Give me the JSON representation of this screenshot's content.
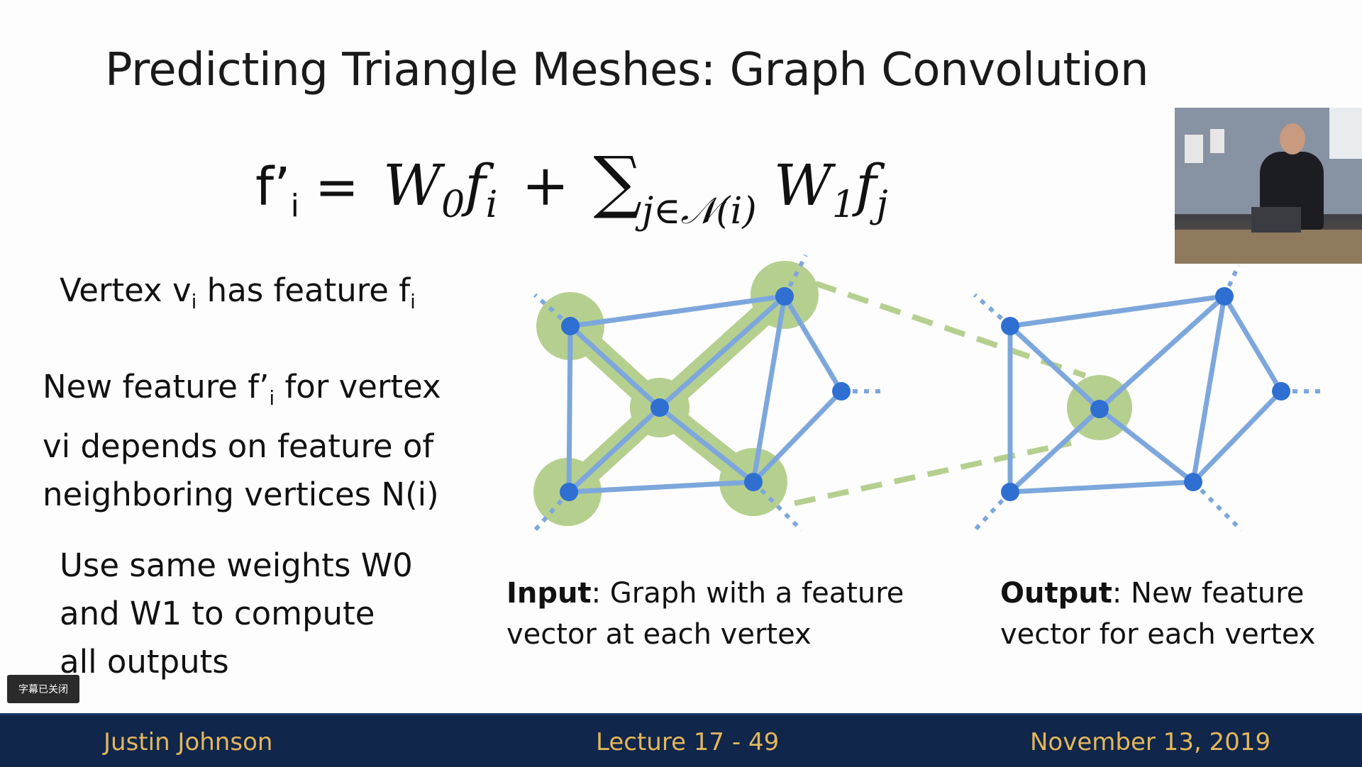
{
  "slide": {
    "title": "Predicting Triangle Meshes: Graph Convolution",
    "formula": {
      "lhs_base": "f’",
      "lhs_sub": "i",
      "equals": "=",
      "w0": "W",
      "w0_sub": "0",
      "f": "f",
      "f_sub": "i",
      "plus": "+",
      "sum": "∑",
      "sum_sub": "j∈𝒩(i)",
      "w1": "W",
      "w1_sub": "1",
      "f2": "f",
      "f2_sub": "j"
    },
    "vertex_text": {
      "part1": "Vertex v",
      "sub1": "i",
      "part2": " has feature f",
      "sub2": "i"
    },
    "new_feature_text": {
      "part1": "New feature f’",
      "sub1": "i",
      "part2": " for vertex",
      "line2": "vi depends on feature of",
      "line3": "neighboring vertices N(i)"
    },
    "weights_text": {
      "line1": "Use same weights W0",
      "line2": "and W1 to compute",
      "line3": "all outputs"
    },
    "input_caption": {
      "bold": "Input",
      "rest": ": Graph with a feature",
      "line2": "vector at each vertex"
    },
    "output_caption": {
      "bold": "Output",
      "rest": ": New feature",
      "line2": "vector for each vertex"
    }
  },
  "subtitle_button": {
    "label": "字幕已关闭"
  },
  "footer": {
    "left": "Justin Johnson",
    "center": "Lecture 17 - 49",
    "right": "November 13, 2019"
  },
  "colors": {
    "graph_edge": "#7da7dc",
    "graph_vertex": "#2e6fd1",
    "highlight": "#b5cf8f",
    "footer_bg": "#10264a",
    "footer_text": "#e4b75c"
  }
}
